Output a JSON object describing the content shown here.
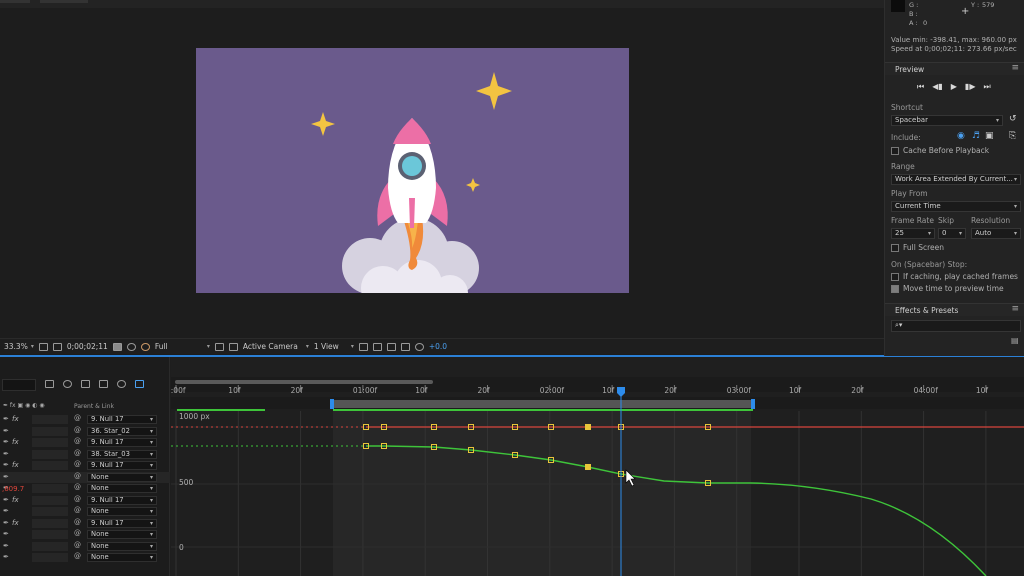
{
  "info": {
    "g": "G :",
    "b": "B :",
    "a_label": "A :",
    "a_value": "0",
    "y_label": "Y :",
    "y_value": "579",
    "plus": "+",
    "value_range": "Value min: -398.41, max: 960.00 px",
    "speed": "Speed at 0;00;02;11: 273.66 px/sec"
  },
  "preview": {
    "title": "Preview",
    "shortcut_label": "Shortcut",
    "shortcut_value": "Spacebar",
    "include_label": "Include:",
    "cache_before_playback": "Cache Before Playback",
    "range_label": "Range",
    "range_value": "Work Area Extended By Current...",
    "play_from_label": "Play From",
    "play_from_value": "Current Time",
    "frame_rate_label": "Frame Rate",
    "skip_label": "Skip",
    "resolution_label": "Resolution",
    "frame_rate_value": "25",
    "skip_value": "0",
    "resolution_value": "Auto",
    "full_screen": "Full Screen",
    "on_stop_label": "On (Spacebar) Stop:",
    "if_caching": "If caching, play cached frames",
    "move_time": "Move time to preview time",
    "move_time_checked": true
  },
  "effects": {
    "title": "Effects & Presets",
    "search_placeholder": "⌕▾"
  },
  "viewer_toolbar": {
    "zoom": "33.3%",
    "timecode": "0;00;02;11",
    "resolution": "Full",
    "camera": "Active Camera",
    "views": "1 View",
    "exposure": "+0.0"
  },
  "layers": {
    "header_parent": "Parent & Link",
    "property_value": ",609.7",
    "rows": [
      {
        "fx": "fx",
        "parent": "9. Null 17"
      },
      {
        "fx": "",
        "parent": "36. Star_02"
      },
      {
        "fx": "fx",
        "parent": "9. Null 17"
      },
      {
        "fx": "",
        "parent": "38. Star_03"
      },
      {
        "fx": "fx",
        "parent": "9. Null 17"
      },
      {
        "fx": "",
        "parent": "None"
      },
      {
        "fx": "",
        "parent": "None"
      },
      {
        "fx": "fx",
        "parent": "9. Null 17"
      },
      {
        "fx": "",
        "parent": "None"
      },
      {
        "fx": "fx",
        "parent": "9. Null 17"
      },
      {
        "fx": "",
        "parent": "None"
      },
      {
        "fx": "",
        "parent": "None"
      },
      {
        "fx": "",
        "parent": "None"
      }
    ]
  },
  "timeline": {
    "ruler_labels": [
      "0:00f",
      "10f",
      "20f",
      "01:00f",
      "10f",
      "20f",
      "02:00f",
      "10f",
      "20f",
      "03:00f",
      "10f",
      "20f",
      "04:00f",
      "10f"
    ],
    "axis_labels": [
      "1000 px",
      "500",
      "0"
    ]
  },
  "colors": {
    "accent_blue": "#2d8ceb",
    "curve_green": "#3ec43a",
    "curve_red": "#d8453c",
    "keyframe_yellow": "#e8c53a",
    "comp_bg": "#6a5a8c"
  }
}
